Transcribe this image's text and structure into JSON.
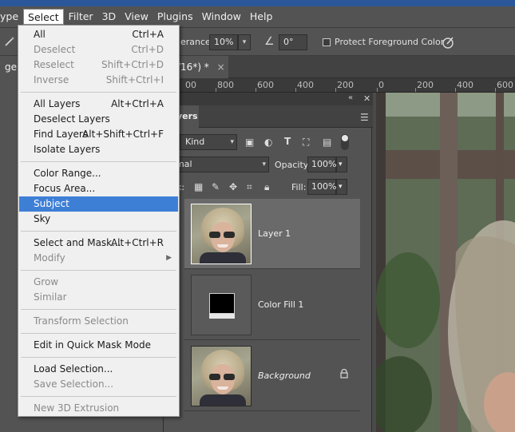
{
  "menubar": {
    "items": [
      "ype",
      "Select",
      "Filter",
      "3D",
      "View",
      "Plugins",
      "Window",
      "Help"
    ],
    "active": "Select"
  },
  "options": {
    "tolerance_label": "erance:",
    "tolerance_value": "10%",
    "angle_value": "0°",
    "protect_label": "Protect Foreground Color"
  },
  "tabs": {
    "doc1": "ge I",
    "doc2": "/16*) *",
    "close_glyph": "×"
  },
  "ruler": {
    "labels": [
      "00",
      "800",
      "600",
      "400",
      "200",
      "0",
      "200",
      "400",
      "600"
    ]
  },
  "layers_panel": {
    "tab_label": "yers",
    "filter_kind": "Kind",
    "blend_mode": "ormal",
    "opacity_label": "Opacity:",
    "opacity_value": "100%",
    "lock_label": "k:",
    "fill_label": "Fill:",
    "fill_value": "100%",
    "layers": [
      {
        "name": "Layer 1",
        "selected": true
      },
      {
        "name": "Color Fill 1",
        "selected": false
      },
      {
        "name": "Background",
        "selected": false,
        "locked": true
      }
    ]
  },
  "select_menu": {
    "all": {
      "label": "All",
      "shortcut": "Ctrl+A"
    },
    "deselect": {
      "label": "Deselect",
      "shortcut": "Ctrl+D"
    },
    "reselect": {
      "label": "Reselect",
      "shortcut": "Shift+Ctrl+D"
    },
    "inverse": {
      "label": "Inverse",
      "shortcut": "Shift+Ctrl+I"
    },
    "all_layers": {
      "label": "All Layers",
      "shortcut": "Alt+Ctrl+A"
    },
    "deselect_layers": {
      "label": "Deselect Layers",
      "shortcut": ""
    },
    "find_layers": {
      "label": "Find Layers",
      "shortcut": "Alt+Shift+Ctrl+F"
    },
    "isolate_layers": {
      "label": "Isolate Layers",
      "shortcut": ""
    },
    "color_range": {
      "label": "Color Range...",
      "shortcut": ""
    },
    "focus_area": {
      "label": "Focus Area...",
      "shortcut": ""
    },
    "subject": {
      "label": "Subject",
      "shortcut": ""
    },
    "sky": {
      "label": "Sky",
      "shortcut": ""
    },
    "select_and_mask": {
      "label": "Select and Mask...",
      "shortcut": "Alt+Ctrl+R"
    },
    "modify": {
      "label": "Modify",
      "shortcut": ""
    },
    "grow": {
      "label": "Grow",
      "shortcut": ""
    },
    "similar": {
      "label": "Similar",
      "shortcut": ""
    },
    "transform_selection": {
      "label": "Transform Selection",
      "shortcut": ""
    },
    "quick_mask": {
      "label": "Edit in Quick Mask Mode",
      "shortcut": ""
    },
    "load_selection": {
      "label": "Load Selection...",
      "shortcut": ""
    },
    "save_selection": {
      "label": "Save Selection...",
      "shortcut": ""
    },
    "new_3d_extrusion": {
      "label": "New 3D Extrusion",
      "shortcut": ""
    }
  },
  "colors": {
    "ui_bg": "#535353",
    "menu_bg": "#f0f0f0",
    "highlight": "#3e7fd6",
    "top_strip": "#2b579a"
  }
}
